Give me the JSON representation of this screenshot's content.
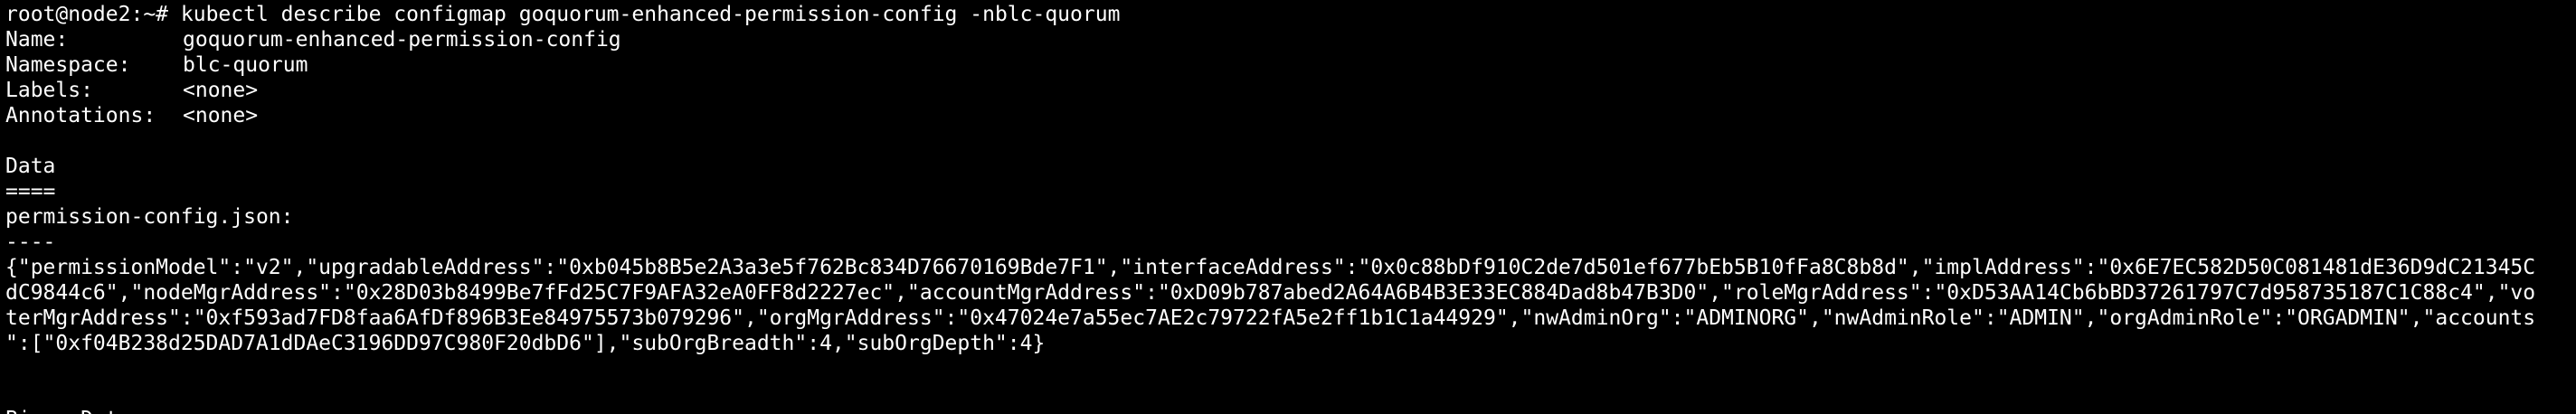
{
  "terminal": {
    "prompt": "root@node2:~#",
    "command": "kubectl describe configmap goquorum-enhanced-permission-config -nblc-quorum",
    "fields": [
      {
        "key": "Name:",
        "value": "goquorum-enhanced-permission-config"
      },
      {
        "key": "Namespace:",
        "value": "blc-quorum"
      },
      {
        "key": "Labels:",
        "value": "<none>"
      },
      {
        "key": "Annotations:",
        "value": "<none>"
      }
    ],
    "data_header": "Data",
    "data_underline": "====",
    "file_key": "permission-config.json:",
    "file_separator": "----",
    "json_lines": [
      "{\"permissionModel\":\"v2\",\"upgradableAddress\":\"0xb045b8B5e2A3a3e5f762Bc834D76670169Bde7F1\",\"interfaceAddress\":\"0x0c88bDf910C2de7d501ef677bEb5B10fFa8C8b8d\",\"implAddress\":\"0x6E7EC582D50C081481dE36D9dC21345C",
      "dC9844c6\",\"nodeMgrAddress\":\"0x28D03b8499Be7fFd25C7F9AFA32eA0FF8d2227ec\",\"accountMgrAddress\":\"0xD09b787abed2A64A6B4B3E33EC884Dad8b47B3D0\",\"roleMgrAddress\":\"0xD53AA14Cb6bBD37261797C7d958735187C1C88c4\",\"vo",
      "terMgrAddress\":\"0xf593ad7FD8faa6AfDf896B3Ee84975573b079296\",\"orgMgrAddress\":\"0x47024e7a55ec7AE2c79722fA5e2ff1b1C1a44929\",\"nwAdminOrg\":\"ADMINORG\",\"nwAdminRole\":\"ADMIN\",\"orgAdminRole\":\"ORGADMIN\",\"accounts",
      "\":[\"0xf04B238d25DAD7A1dDAeC3196DD97C980F20dbD6\"],\"subOrgBreadth\":4,\"subOrgDepth\":4}"
    ],
    "trailing_partial": "BinaryData"
  }
}
